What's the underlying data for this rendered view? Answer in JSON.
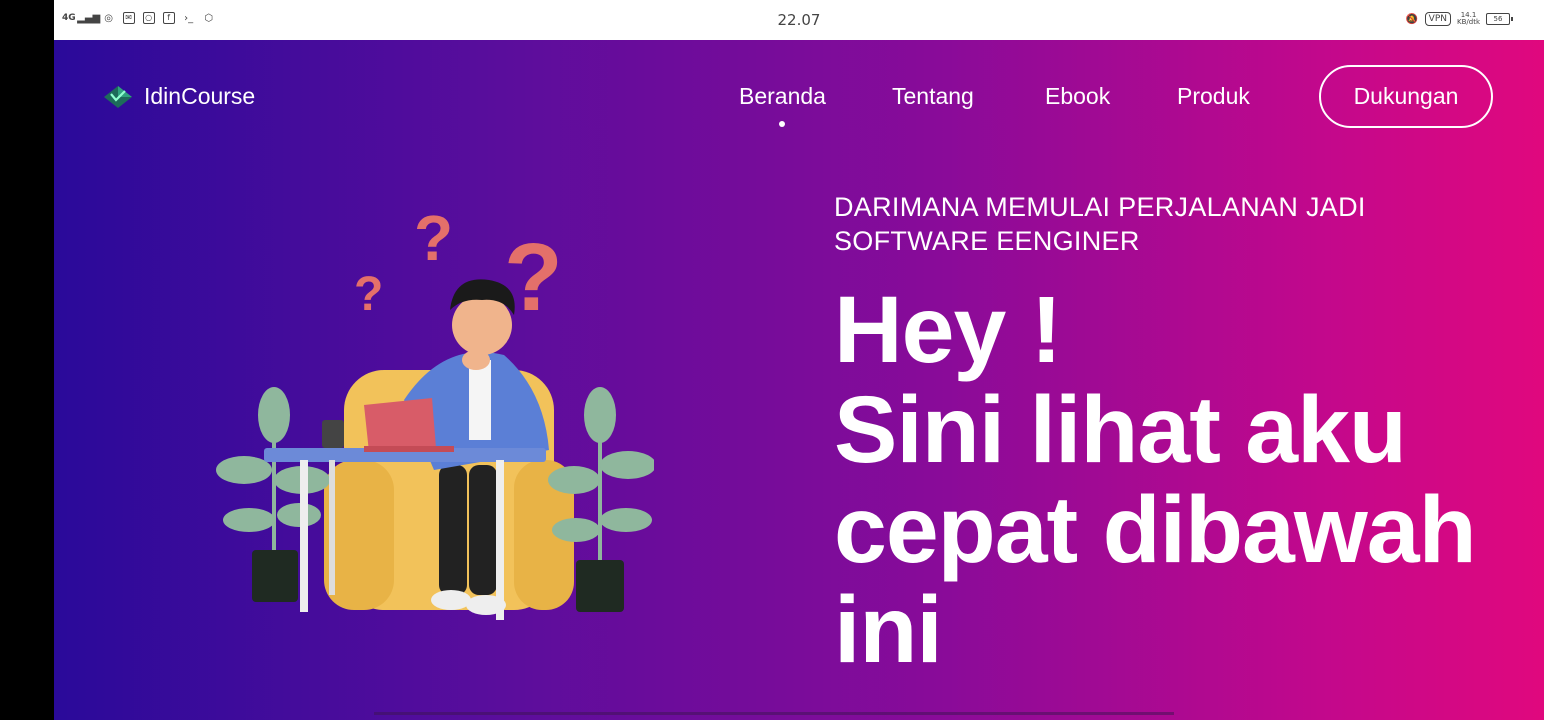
{
  "statusbar": {
    "time": "22.07",
    "network": "4G",
    "vpn_label": "VPN",
    "speed_value": "14.1",
    "speed_unit": "KB/dtk",
    "battery": "56"
  },
  "nav": {
    "brand": "IdinCourse",
    "items": [
      "Beranda",
      "Tentang",
      "Ebook",
      "Produk"
    ],
    "active_index": 0,
    "cta": "Dukungan"
  },
  "hero": {
    "subtitle_line1": "DARIMANA MEMULAI PERJALANAN JADI",
    "subtitle_line2": "SOFTWARE EENGINER",
    "headline": [
      "Hey !",
      "Sini lihat aku",
      "cepat dibawah",
      "ini"
    ]
  },
  "colors": {
    "gradient_start": "#2a0a9a",
    "gradient_end": "#e0087e",
    "text": "#ffffff"
  }
}
